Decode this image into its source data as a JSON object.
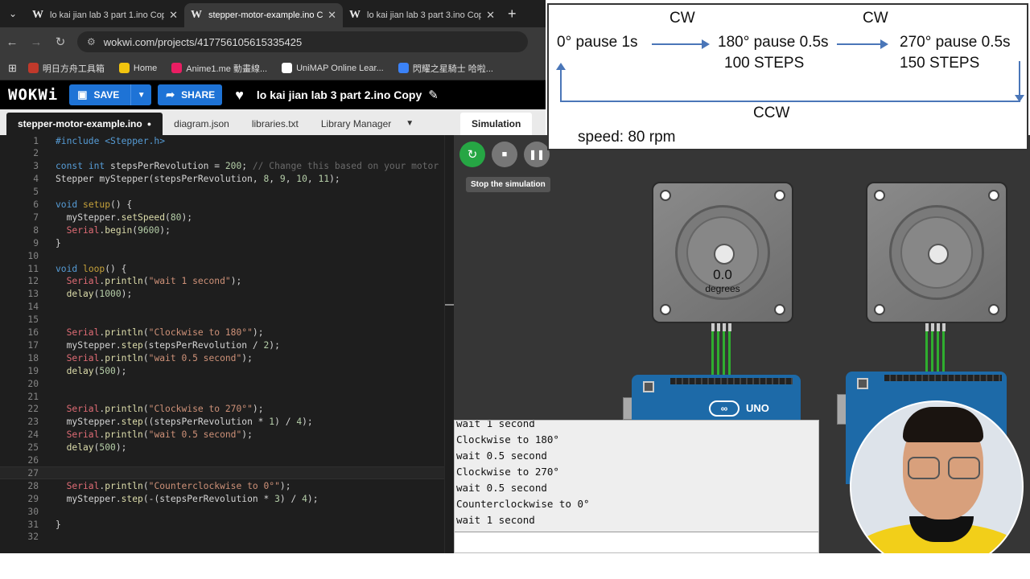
{
  "browser": {
    "tabs": [
      {
        "title": "lo kai jian lab 3 part 1.ino Copy",
        "active": false
      },
      {
        "title": "stepper-motor-example.ino Cop",
        "active": true
      },
      {
        "title": "lo kai jian lab 3 part 3.ino Copy",
        "active": false
      }
    ],
    "url_host": "wokwi.com/projects/417756105615335425",
    "bookmarks": [
      {
        "label": "明日方舟工具箱",
        "color": "#c0392b"
      },
      {
        "label": "Home",
        "color": "#f1c40f"
      },
      {
        "label": "Anime1.me 動畫線...",
        "color": "#e91e63"
      },
      {
        "label": "UniMAP Online Lear...",
        "color": "#ffffff"
      },
      {
        "label": "閃耀之星騎士 哈啦...",
        "color": "#3b82f6"
      }
    ]
  },
  "wokwi": {
    "logo": "WOKWi",
    "save_label": "SAVE",
    "share_label": "SHARE",
    "project_name": "lo kai jian lab 3 part 2.ino Copy"
  },
  "editor": {
    "tabs": [
      {
        "label": "stepper-motor-example.ino",
        "active": true,
        "modified": true
      },
      {
        "label": "diagram.json",
        "active": false
      },
      {
        "label": "libraries.txt",
        "active": false
      },
      {
        "label": "Library Manager",
        "active": false
      }
    ],
    "current_line": 27,
    "lines": [
      [
        {
          "t": "#include <Stepper.h>",
          "c": "#569cd6"
        }
      ],
      [],
      [
        {
          "t": "const ",
          "c": "#569cd6"
        },
        {
          "t": "int ",
          "c": "#569cd6"
        },
        {
          "t": "stepsPerRevolution = ",
          "c": "#d4d4d4"
        },
        {
          "t": "200",
          "c": "#b5cea8"
        },
        {
          "t": "; ",
          "c": "#d4d4d4"
        },
        {
          "t": "// Change this based on your motor",
          "c": "#6a6a6a"
        }
      ],
      [
        {
          "t": "Stepper myStepper(stepsPerRevolution, ",
          "c": "#d4d4d4"
        },
        {
          "t": "8",
          "c": "#b5cea8"
        },
        {
          "t": ", ",
          "c": "#d4d4d4"
        },
        {
          "t": "9",
          "c": "#b5cea8"
        },
        {
          "t": ", ",
          "c": "#d4d4d4"
        },
        {
          "t": "10",
          "c": "#b5cea8"
        },
        {
          "t": ", ",
          "c": "#d4d4d4"
        },
        {
          "t": "11",
          "c": "#b5cea8"
        },
        {
          "t": ");",
          "c": "#d4d4d4"
        }
      ],
      [],
      [
        {
          "t": "void ",
          "c": "#569cd6"
        },
        {
          "t": "setup",
          "c": "#c5a13a"
        },
        {
          "t": "() {",
          "c": "#d4d4d4"
        }
      ],
      [
        {
          "t": "  myStepper.",
          "c": "#d4d4d4"
        },
        {
          "t": "setSpeed",
          "c": "#dcdcaa"
        },
        {
          "t": "(",
          "c": "#d4d4d4"
        },
        {
          "t": "80",
          "c": "#b5cea8"
        },
        {
          "t": ");",
          "c": "#d4d4d4"
        }
      ],
      [
        {
          "t": "  Serial",
          "c": "#e06c75"
        },
        {
          "t": ".",
          "c": "#d4d4d4"
        },
        {
          "t": "begin",
          "c": "#dcdcaa"
        },
        {
          "t": "(",
          "c": "#d4d4d4"
        },
        {
          "t": "9600",
          "c": "#b5cea8"
        },
        {
          "t": ");",
          "c": "#d4d4d4"
        }
      ],
      [
        {
          "t": "}",
          "c": "#d4d4d4"
        }
      ],
      [],
      [
        {
          "t": "void ",
          "c": "#569cd6"
        },
        {
          "t": "loop",
          "c": "#c5a13a"
        },
        {
          "t": "() {",
          "c": "#d4d4d4"
        }
      ],
      [
        {
          "t": "  Serial",
          "c": "#e06c75"
        },
        {
          "t": ".",
          "c": "#d4d4d4"
        },
        {
          "t": "println",
          "c": "#dcdcaa"
        },
        {
          "t": "(",
          "c": "#d4d4d4"
        },
        {
          "t": "\"wait 1 second\"",
          "c": "#ce9178"
        },
        {
          "t": ");",
          "c": "#d4d4d4"
        }
      ],
      [
        {
          "t": "  delay",
          "c": "#dcdcaa"
        },
        {
          "t": "(",
          "c": "#d4d4d4"
        },
        {
          "t": "1000",
          "c": "#b5cea8"
        },
        {
          "t": ");",
          "c": "#d4d4d4"
        }
      ],
      [],
      [],
      [
        {
          "t": "  Serial",
          "c": "#e06c75"
        },
        {
          "t": ".",
          "c": "#d4d4d4"
        },
        {
          "t": "println",
          "c": "#dcdcaa"
        },
        {
          "t": "(",
          "c": "#d4d4d4"
        },
        {
          "t": "\"Clockwise to 180°\"",
          "c": "#ce9178"
        },
        {
          "t": ");",
          "c": "#d4d4d4"
        }
      ],
      [
        {
          "t": "  myStepper.",
          "c": "#d4d4d4"
        },
        {
          "t": "step",
          "c": "#dcdcaa"
        },
        {
          "t": "(stepsPerRevolution / ",
          "c": "#d4d4d4"
        },
        {
          "t": "2",
          "c": "#b5cea8"
        },
        {
          "t": ");",
          "c": "#d4d4d4"
        }
      ],
      [
        {
          "t": "  Serial",
          "c": "#e06c75"
        },
        {
          "t": ".",
          "c": "#d4d4d4"
        },
        {
          "t": "println",
          "c": "#dcdcaa"
        },
        {
          "t": "(",
          "c": "#d4d4d4"
        },
        {
          "t": "\"wait 0.5 second\"",
          "c": "#ce9178"
        },
        {
          "t": ");",
          "c": "#d4d4d4"
        }
      ],
      [
        {
          "t": "  delay",
          "c": "#dcdcaa"
        },
        {
          "t": "(",
          "c": "#d4d4d4"
        },
        {
          "t": "500",
          "c": "#b5cea8"
        },
        {
          "t": ");",
          "c": "#d4d4d4"
        }
      ],
      [],
      [],
      [
        {
          "t": "  Serial",
          "c": "#e06c75"
        },
        {
          "t": ".",
          "c": "#d4d4d4"
        },
        {
          "t": "println",
          "c": "#dcdcaa"
        },
        {
          "t": "(",
          "c": "#d4d4d4"
        },
        {
          "t": "\"Clockwise to 270°\"",
          "c": "#ce9178"
        },
        {
          "t": ");",
          "c": "#d4d4d4"
        }
      ],
      [
        {
          "t": "  myStepper.",
          "c": "#d4d4d4"
        },
        {
          "t": "step",
          "c": "#dcdcaa"
        },
        {
          "t": "((stepsPerRevolution * ",
          "c": "#d4d4d4"
        },
        {
          "t": "1",
          "c": "#b5cea8"
        },
        {
          "t": ") / ",
          "c": "#d4d4d4"
        },
        {
          "t": "4",
          "c": "#b5cea8"
        },
        {
          "t": ");",
          "c": "#d4d4d4"
        }
      ],
      [
        {
          "t": "  Serial",
          "c": "#e06c75"
        },
        {
          "t": ".",
          "c": "#d4d4d4"
        },
        {
          "t": "println",
          "c": "#dcdcaa"
        },
        {
          "t": "(",
          "c": "#d4d4d4"
        },
        {
          "t": "\"wait 0.5 second\"",
          "c": "#ce9178"
        },
        {
          "t": ");",
          "c": "#d4d4d4"
        }
      ],
      [
        {
          "t": "  delay",
          "c": "#dcdcaa"
        },
        {
          "t": "(",
          "c": "#d4d4d4"
        },
        {
          "t": "500",
          "c": "#b5cea8"
        },
        {
          "t": ");",
          "c": "#d4d4d4"
        }
      ],
      [],
      [],
      [
        {
          "t": "  Serial",
          "c": "#e06c75"
        },
        {
          "t": ".",
          "c": "#d4d4d4"
        },
        {
          "t": "println",
          "c": "#dcdcaa"
        },
        {
          "t": "(",
          "c": "#d4d4d4"
        },
        {
          "t": "\"Counterclockwise to 0°\"",
          "c": "#ce9178"
        },
        {
          "t": ");",
          "c": "#d4d4d4"
        }
      ],
      [
        {
          "t": "  myStepper.",
          "c": "#d4d4d4"
        },
        {
          "t": "step",
          "c": "#dcdcaa"
        },
        {
          "t": "(-(stepsPerRevolution * ",
          "c": "#d4d4d4"
        },
        {
          "t": "3",
          "c": "#b5cea8"
        },
        {
          "t": ") / ",
          "c": "#d4d4d4"
        },
        {
          "t": "4",
          "c": "#b5cea8"
        },
        {
          "t": ");",
          "c": "#d4d4d4"
        }
      ],
      [],
      [
        {
          "t": "}",
          "c": "#d4d4d4"
        }
      ],
      []
    ]
  },
  "simulation": {
    "tab_label": "Simulation",
    "tooltip": "Stop the simulation",
    "motor1": {
      "value": "0.0",
      "unit": "degrees"
    },
    "board_label": "UNO",
    "serial_lines": [
      "wait 1 second",
      "Clockwise to 180°",
      "wait 0.5 second",
      "Clockwise to 270°",
      "wait 0.5 second",
      "Counterclockwise to 0°",
      "wait 1 second"
    ]
  },
  "diagram": {
    "cw1": "CW",
    "cw2": "CW",
    "start": "0°  pause 1s",
    "mid": "180° pause 0.5s",
    "mid_steps": "100 STEPS",
    "end": "270° pause 0.5s",
    "end_steps": "150 STEPS",
    "ccw": "CCW",
    "speed": "speed: 80 rpm"
  },
  "colors": {
    "wokwi_blue": "#1e73d6",
    "restart_green": "#26a644",
    "arrow_blue": "#4a76b8"
  }
}
